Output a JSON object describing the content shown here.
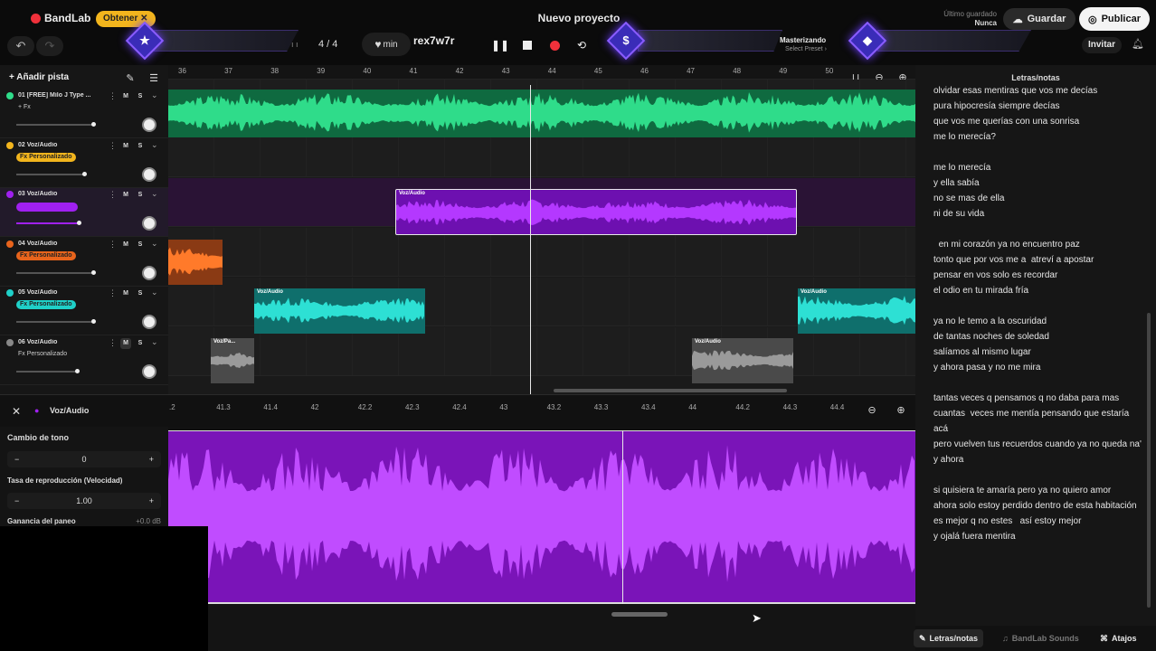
{
  "app": {
    "logo": "BandLab",
    "get_label": "Obtener",
    "title": "Nuevo proyecto",
    "saved_label": "Último guardado",
    "saved_value": "Nunca",
    "save_label": "Guardar",
    "publish_label": "Publicar",
    "invite_label": "Invitar"
  },
  "transport": {
    "time_signature": "4 / 4",
    "tempo_unit": "min",
    "key": "rex7w7r",
    "mastering_label": "Masterizando",
    "mastering_preset": "Select Preset"
  },
  "tracks_panel": {
    "add_track_label": "Añadir pista"
  },
  "tracks": [
    {
      "name": "01  [FREE] Milo J Type ...",
      "sub": "+ Fx",
      "fx": "",
      "m": "M",
      "s": "S"
    },
    {
      "name": "02  Voz/Audio",
      "sub": "",
      "fx": "Fx  Personalizado",
      "m": "M",
      "s": "S"
    },
    {
      "name": "03  Voz/Audio",
      "sub": "",
      "fx": "",
      "m": "M",
      "s": "S"
    },
    {
      "name": "04  Voz/Audio",
      "sub": "",
      "fx": "Fx  Personalizado",
      "m": "M",
      "s": "S"
    },
    {
      "name": "05  Voz/Audio",
      "sub": "",
      "fx": "Fx  Personalizado",
      "m": "M",
      "s": "S"
    },
    {
      "name": "06  Voz/Audio",
      "sub": "Fx  Personalizado",
      "fx": "",
      "m": "M",
      "s": "S"
    }
  ],
  "ruler_bars": [
    "36",
    "37",
    "38",
    "39",
    "40",
    "41",
    "42",
    "43",
    "44",
    "45",
    "46",
    "47",
    "48",
    "49",
    "50"
  ],
  "clips": {
    "c3": "Voz/Audio",
    "c5a": "Voz/Audio",
    "c5b": "Voz/Audio",
    "c6a": "Voz/Pa...",
    "c6b": "Voz/Audio"
  },
  "editor": {
    "title": "Voz/Audio",
    "ruler": [
      ".2",
      "41.3",
      "41.4",
      "42",
      "42.2",
      "42.3",
      "42.4",
      "43",
      "43.2",
      "43.3",
      "43.4",
      "44",
      "44.2",
      "44.3",
      "44.4"
    ],
    "pitch_label": "Cambio de tono",
    "pitch_value": "0",
    "rate_label": "Tasa de reproducción (Velocidad)",
    "rate_value": "1.00",
    "gain_label": "Ganancia del paneo",
    "gain_value": "+0.0 dB"
  },
  "lyrics_panel": {
    "title": "Letras/notas",
    "lines": [
      "olvidar esas mentiras que vos me decías",
      "pura hipocresía siempre decías",
      "que vos me querías con una sonrisa",
      "me lo merecía?",
      "",
      "me lo merecía",
      "y ella sabía",
      "no se mas de ella",
      "ni de su vida",
      "",
      "  en mi corazón ya no encuentro paz",
      "tonto que por vos me a  atreví a apostar",
      "pensar en vos solo es recordar",
      "el odio en tu mirada fría",
      "",
      "ya no le temo a la oscuridad",
      "de tantas noches de soledad",
      "salíamos al mismo lugar",
      "y ahora pasa y no me mira",
      "",
      "tantas veces q pensamos q no daba para mas",
      "cuantas  veces me mentía pensando que estaría acá",
      "pero vuelven tus recuerdos cuando ya no queda na'",
      "y ahora",
      "",
      "si quisiera te amaría pero ya no quiero amor",
      "ahora solo estoy perdido dentro de esta habitación",
      "es mejor q no estes   así estoy mejor",
      "y ojalá fuera mentira"
    ]
  },
  "bottom_tabs": {
    "lyrics": "Letras/notas",
    "sounds": "BandLab Sounds",
    "shortcuts": "Atajos"
  },
  "colors": {
    "accent": "#f0313b",
    "get": "#f2b51d",
    "green": "#2fdc8a",
    "purple": "#a020f0",
    "orange": "#e8641c",
    "teal": "#1fd0c8",
    "gray": "#9a9a9a"
  }
}
